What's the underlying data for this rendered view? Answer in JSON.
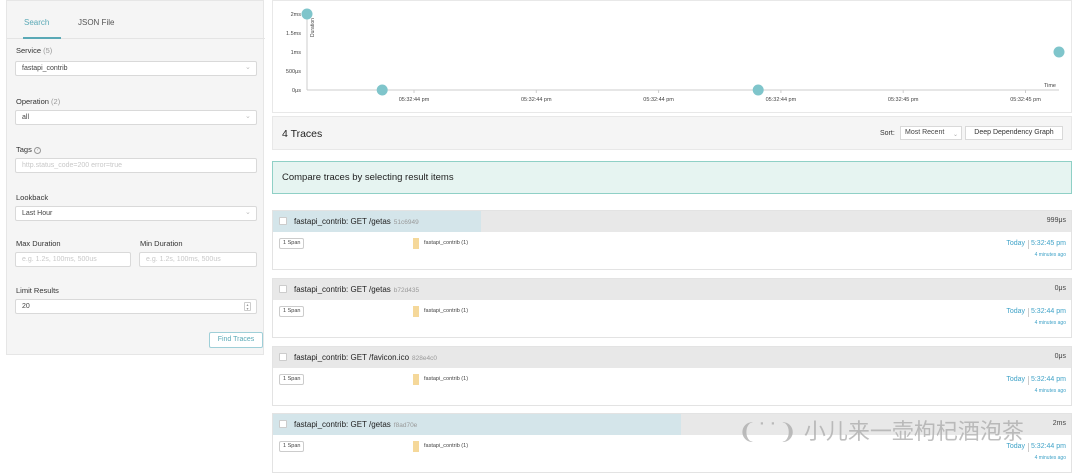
{
  "search_panel": {
    "tabs": [
      {
        "label": "Search",
        "active": true
      },
      {
        "label": "JSON File",
        "active": false
      }
    ],
    "service": {
      "label": "Service",
      "count": "(5)",
      "value": "fastapi_contrib"
    },
    "operation": {
      "label": "Operation",
      "count": "(2)",
      "value": "all"
    },
    "tags": {
      "label": "Tags",
      "help_icon": "question-circle-icon",
      "placeholder": "http.status_code=200 error=true"
    },
    "lookback": {
      "label": "Lookback",
      "value": "Last Hour"
    },
    "max_duration": {
      "label": "Max Duration",
      "placeholder": "e.g. 1.2s, 100ms, 500us"
    },
    "min_duration": {
      "label": "Min Duration",
      "placeholder": "e.g. 1.2s, 100ms, 500us"
    },
    "limit_results": {
      "label": "Limit Results",
      "value": "20"
    },
    "find_button": "Find Traces"
  },
  "chart_data": {
    "type": "scatter",
    "y_ticks": [
      "2ms",
      "1.5ms",
      "1ms",
      "500μs",
      "0μs"
    ],
    "y_label": "Duration",
    "x_label": "Time",
    "x_ticks": [
      "05:32:44 pm",
      "05:32:44 pm",
      "05:32:44 pm",
      "05:32:44 pm",
      "05:32:45 pm",
      "05:32:45 pm"
    ],
    "points": [
      {
        "x_index": 0.0,
        "y_ms": 2.0
      },
      {
        "x_index": 0.1,
        "y_ms": 0.0
      },
      {
        "x_index": 0.6,
        "y_ms": 0.0
      },
      {
        "x_index": 1.0,
        "y_ms": 0.999
      }
    ],
    "ylim": [
      0,
      2
    ],
    "point_color": "#7fc5cb"
  },
  "results_header": {
    "count": "4 Traces",
    "sort_label": "Sort:",
    "sort_value": "Most Recent",
    "deep_dependency_button": "Deep Dependency Graph"
  },
  "compare_banner": "Compare traces by selecting result items",
  "traces": [
    {
      "name": "fastapi_contrib: GET /getas",
      "id": "51c6949",
      "duration": "999μs",
      "bar_fraction": 0.51,
      "spans": "1 Span",
      "service": "fastapi_contrib (1)",
      "day": "Today",
      "time": "5:32:45 pm",
      "ago": "4 minutes ago"
    },
    {
      "name": "fastapi_contrib: GET /getas",
      "id": "b72d435",
      "duration": "0μs",
      "bar_fraction": 0,
      "spans": "1 Span",
      "service": "fastapi_contrib (1)",
      "day": "Today",
      "time": "5:32:44 pm",
      "ago": "4 minutes ago"
    },
    {
      "name": "fastapi_contrib: GET /favicon.ico",
      "id": "828e4c0",
      "duration": "0μs",
      "bar_fraction": 0,
      "spans": "1 Span",
      "service": "fastapi_contrib (1)",
      "day": "Today",
      "time": "5:32:44 pm",
      "ago": "4 minutes ago"
    },
    {
      "name": "fastapi_contrib: GET /getas",
      "id": "f8ad70e",
      "duration": "2ms",
      "bar_fraction": 1.0,
      "spans": "1 Span",
      "service": "fastapi_contrib (1)",
      "day": "Today",
      "time": "5:32:44 pm",
      "ago": "4 minutes ago"
    }
  ],
  "watermark": "小儿来一壶枸杞酒泡茶"
}
